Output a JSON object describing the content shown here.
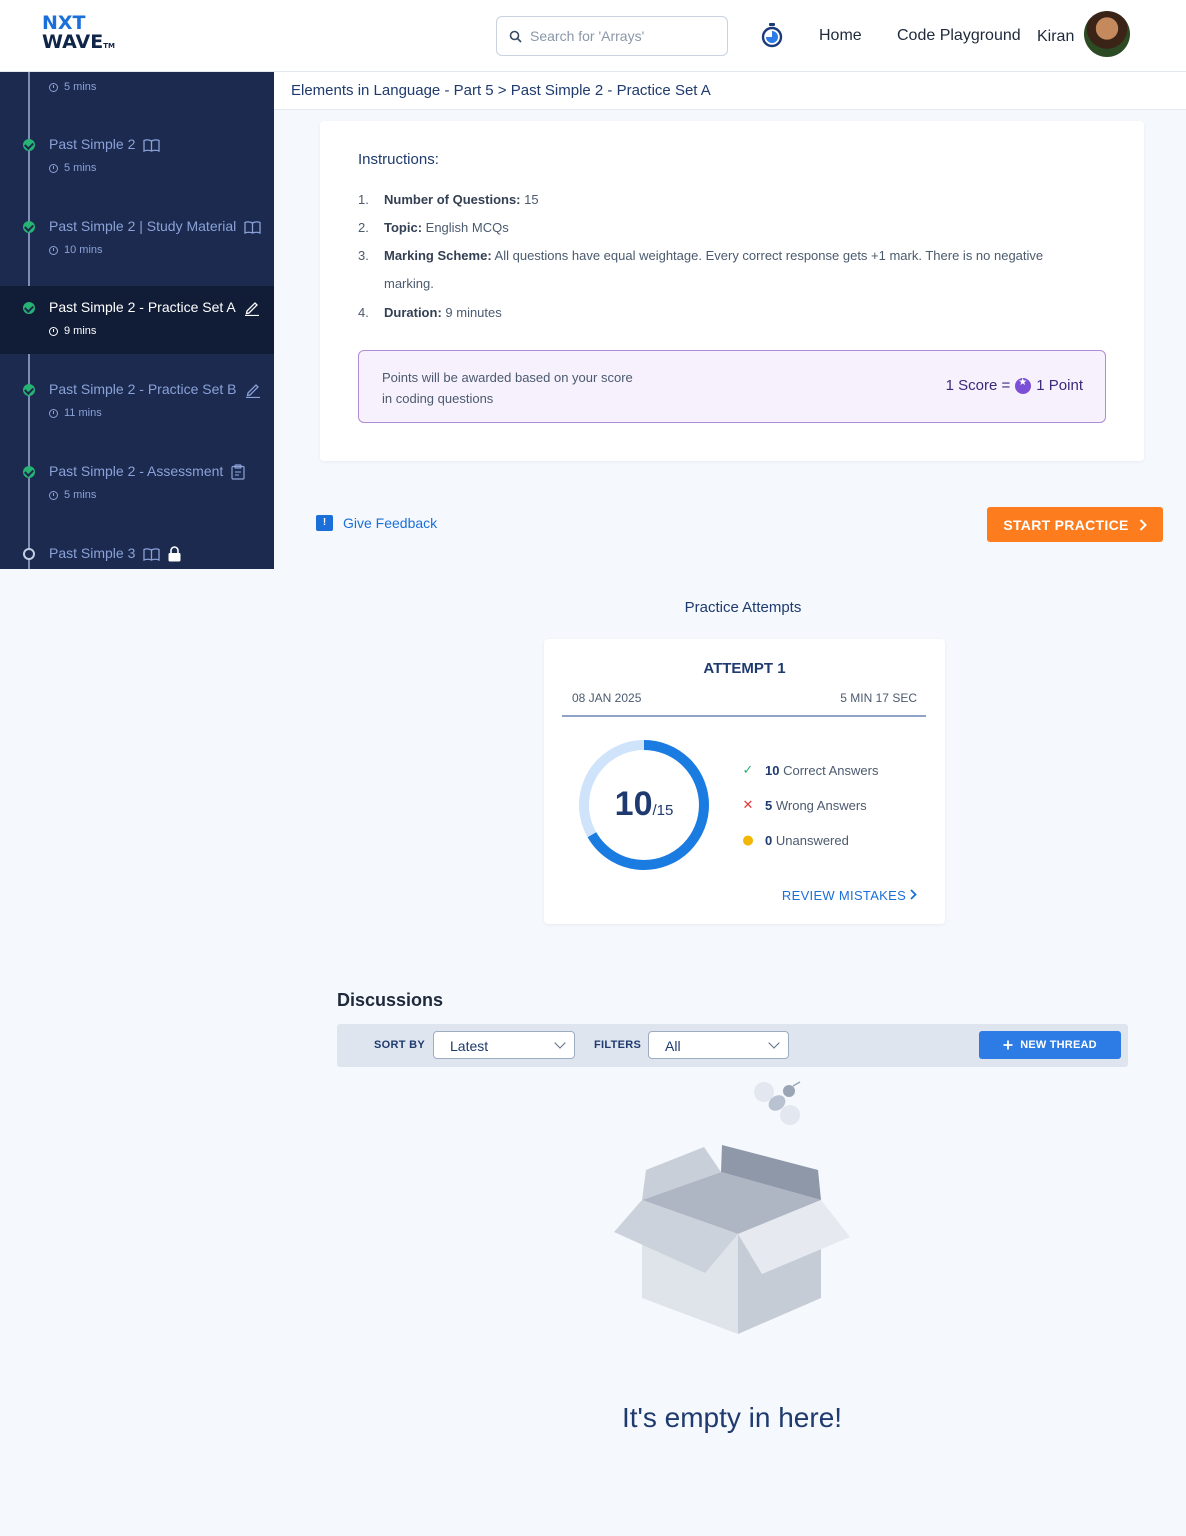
{
  "header": {
    "logo_top": "NXT",
    "logo_bottom": "WAVE",
    "logo_tm": "TM",
    "search_placeholder": "Search for 'Arrays'",
    "nav": [
      "Home",
      "Code Playground"
    ],
    "user_name": "Kiran"
  },
  "sidebar": {
    "items": [
      {
        "title": "",
        "duration": "5 mins",
        "status": "done",
        "icon": "none"
      },
      {
        "title": "Past Simple 2",
        "duration": "5 mins",
        "status": "done",
        "icon": "book-icon"
      },
      {
        "title": "Past Simple 2 | Study Material",
        "duration": "10 mins",
        "status": "done",
        "icon": "book-icon"
      },
      {
        "title": "Past Simple 2 - Practice Set A",
        "duration": "9 mins",
        "status": "done",
        "icon": "pencil-icon",
        "active": true
      },
      {
        "title": "Past Simple 2 - Practice Set B",
        "duration": "11 mins",
        "status": "done",
        "icon": "pencil-icon"
      },
      {
        "title": "Past Simple 2 - Assessment",
        "duration": "5 mins",
        "status": "done",
        "icon": "clipboard-icon"
      },
      {
        "title": "Past Simple 3",
        "duration": "",
        "status": "open",
        "icon": "book-icon",
        "locked": true
      }
    ]
  },
  "breadcrumb": "Elements in Language - Part 5 > Past Simple 2 - Practice Set A",
  "instructions": {
    "heading": "Instructions:",
    "items": [
      {
        "num": "1.",
        "label": "Number of Questions:",
        "value": " 15"
      },
      {
        "num": "2.",
        "label": "Topic:",
        "value": " English MCQs"
      },
      {
        "num": "3.",
        "label": "Marking Scheme:",
        "value": " All questions have equal weightage. Every correct response gets +1 mark. There is no negative",
        "value_cont": "marking."
      },
      {
        "num": "4.",
        "label": "Duration:",
        "value": "  9 minutes"
      }
    ],
    "points_text": "Points will be awarded based on your score in coding questions",
    "points_score": "1 Score =",
    "points_point": "1 Point"
  },
  "feedback_label": "Give Feedback",
  "start_label": "START PRACTICE",
  "attempts": {
    "title": "Practice Attempts",
    "card": {
      "heading": "ATTEMPT 1",
      "date": "08 JAN 2025",
      "duration": "5 MIN 17 SEC",
      "score": "10",
      "total": "/15",
      "score_fraction": 0.667,
      "correct_count": "10",
      "correct_label": "Correct Answers",
      "wrong_count": "5",
      "wrong_label": "Wrong Answers",
      "unanswered_count": "0",
      "unanswered_label": "Unanswered",
      "review_label": "REVIEW MISTAKES"
    }
  },
  "discussions": {
    "title": "Discussions",
    "sort_label": "SORT BY",
    "sort_value": "Latest",
    "filter_label": "FILTERS",
    "filter_value": "All",
    "new_thread_label": "NEW THREAD",
    "empty_text": "It's empty in here!"
  },
  "colors": {
    "sidebar_bg": "#1b2a4e",
    "accent_orange": "#fd7c1e",
    "accent_blue": "#2d7be5",
    "success": "#27b374",
    "error": "#e5383b",
    "warning": "#f2b705"
  }
}
